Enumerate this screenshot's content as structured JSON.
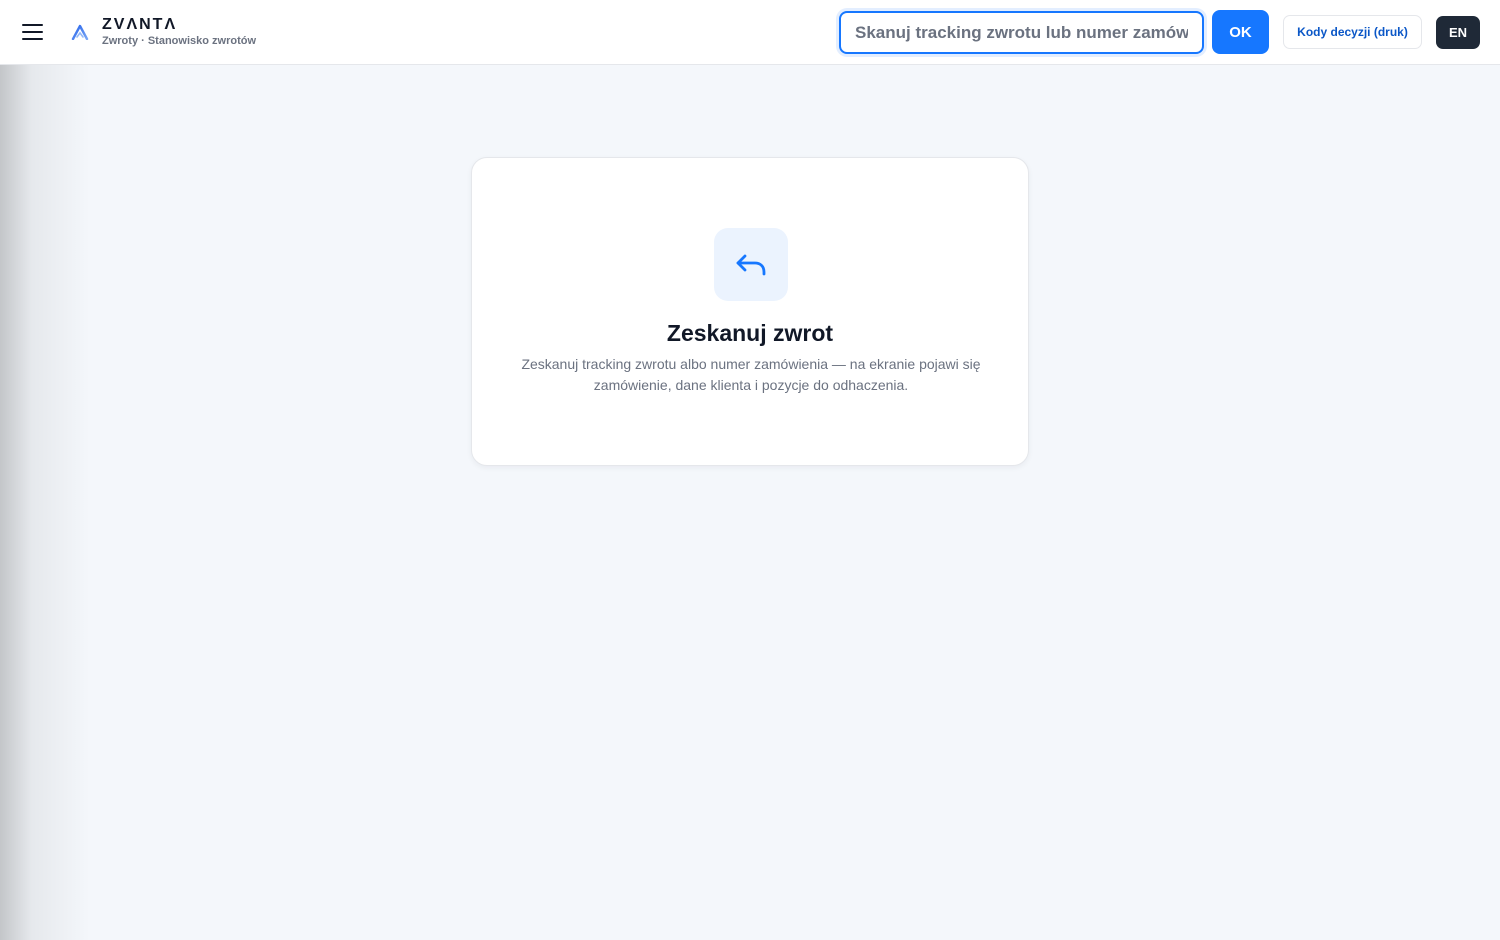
{
  "header": {
    "menu_icon": "hamburger-icon",
    "logo_icon": "zvanta-logo-icon",
    "brand_name": "ZVΛNTΛ",
    "brand_subtitle": "Zwroty · Stanowisko zwrotów",
    "search": {
      "placeholder": "Skanuj tracking zwrotu lub numer zamówienia",
      "value": ""
    },
    "ok_label": "OK",
    "codes_label": "Kody decyzji (druk)",
    "lang_label": "EN"
  },
  "empty_state": {
    "icon": "reply-arrow-icon",
    "title": "Zeskanuj zwrot",
    "description": "Zeskanuj tracking zwrotu albo numer zamówienia — na ekranie pojawi się zamówienie, dane klienta i pozycje do odhaczenia."
  },
  "colors": {
    "accent": "#1677ff",
    "background": "#f4f7fb",
    "dark_button": "#1f2937"
  }
}
